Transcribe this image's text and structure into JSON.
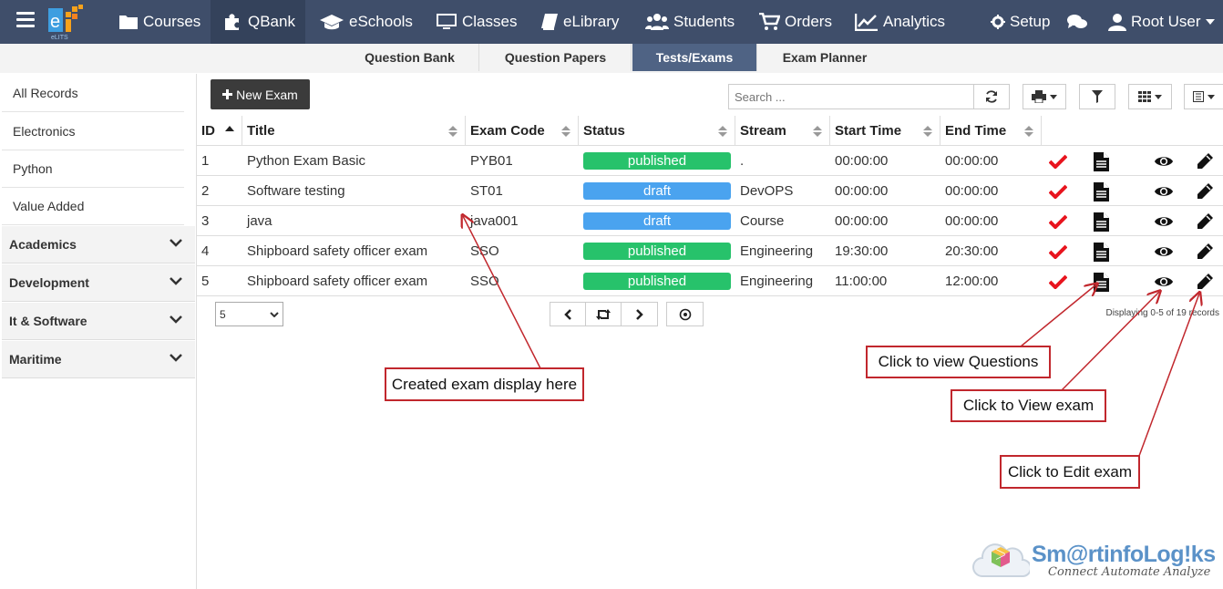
{
  "nav": {
    "brand_text": "eLITS",
    "items": [
      {
        "label": "Courses",
        "icon": "folder-icon"
      },
      {
        "label": "QBank",
        "icon": "puzzle-icon"
      },
      {
        "label": "eSchools",
        "icon": "graduation-cap-icon"
      },
      {
        "label": "Classes",
        "icon": "monitor-icon"
      },
      {
        "label": "eLibrary",
        "icon": "book-icon"
      },
      {
        "label": "Students",
        "icon": "users-icon"
      },
      {
        "label": "Orders",
        "icon": "cart-icon"
      },
      {
        "label": "Analytics",
        "icon": "line-chart-icon"
      }
    ],
    "setup_label": "Setup",
    "user_label": "Root User",
    "active": "QBank"
  },
  "subnav": {
    "tabs": [
      "Question Bank",
      "Question Papers",
      "Tests/Exams",
      "Exam Planner"
    ],
    "active": "Tests/Exams"
  },
  "sidebar": {
    "items": [
      "All Records",
      "Electronics",
      "Python",
      "Value Added"
    ],
    "categories": [
      "Academics",
      "Development",
      "It & Software",
      "Maritime"
    ]
  },
  "toolbar": {
    "new_label": "New Exam",
    "search_placeholder": "Search ..."
  },
  "table": {
    "columns": [
      "ID",
      "Title",
      "Exam Code",
      "Status",
      "Stream",
      "Start Time",
      "End Time"
    ],
    "rows": [
      {
        "id": "1",
        "title": "Python Exam Basic",
        "code": "PYB01",
        "status": "published",
        "stream": ".",
        "start": "00:00:00",
        "end": "00:00:00"
      },
      {
        "id": "2",
        "title": "Software testing",
        "code": "ST01",
        "status": "draft",
        "stream": "DevOPS",
        "start": "00:00:00",
        "end": "00:00:00"
      },
      {
        "id": "3",
        "title": "java",
        "code": "java001",
        "status": "draft",
        "stream": "Course",
        "start": "00:00:00",
        "end": "00:00:00"
      },
      {
        "id": "4",
        "title": "Shipboard safety officer exam",
        "code": "SSO",
        "status": "published",
        "stream": "Engineering",
        "start": "19:30:00",
        "end": "20:30:00"
      },
      {
        "id": "5",
        "title": "Shipboard safety officer exam",
        "code": "SSO",
        "status": "published",
        "stream": "Engineering",
        "start": "11:00:00",
        "end": "12:00:00"
      }
    ]
  },
  "pagination": {
    "page_size": "5",
    "count_text": "Displaying 0-5 of 19 records"
  },
  "annotations": {
    "created": "Created exam display here",
    "questions": "Click to view Questions",
    "view": "Click to View exam",
    "edit": "Click to Edit exam"
  },
  "watermark": {
    "title": "Sm@rtinfoLog!ks",
    "tagline": "Connect Automate Analyze"
  },
  "colors": {
    "nav_bg": "#3f4e6a",
    "published": "#27c26b",
    "draft": "#4aa3ef",
    "check": "#e8141e",
    "callout_border": "#c1272d"
  }
}
